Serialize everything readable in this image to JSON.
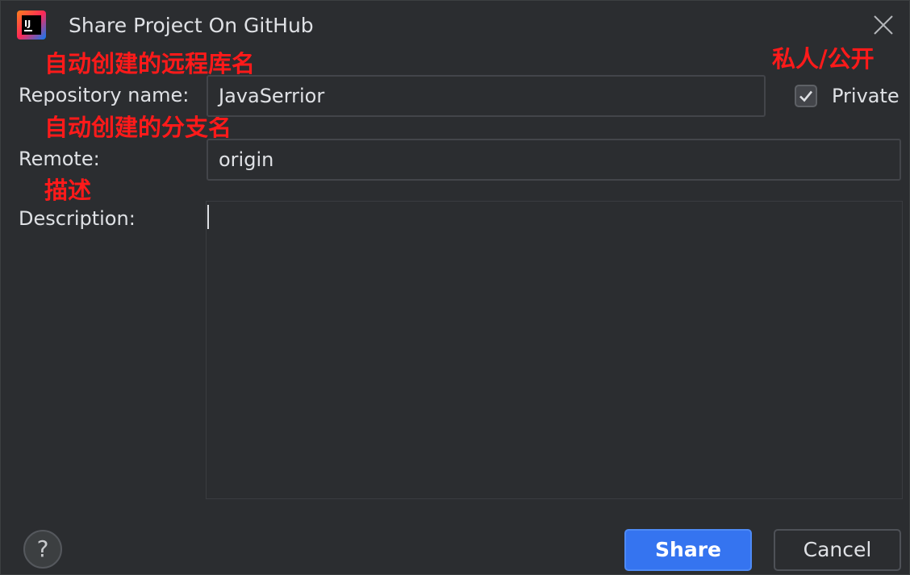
{
  "window": {
    "title": "Share Project On GitHub",
    "app_icon": "intellij-idea-icon",
    "close_icon": "close-icon"
  },
  "annotations": {
    "repo_name_note": "自动创建的远程库名",
    "remote_note": "自动创建的分支名",
    "description_note": "描述",
    "private_note": "私人/公开"
  },
  "form": {
    "repository_name_label": "Repository name:",
    "repository_name_value": "JavaSerrior",
    "remote_label": "Remote:",
    "remote_value": "origin",
    "description_label": "Description:",
    "description_value": "",
    "private_label": "Private",
    "private_checked": true
  },
  "footer": {
    "help_label": "?",
    "share_label": "Share",
    "cancel_label": "Cancel"
  },
  "colors": {
    "background": "#2b2d30",
    "annotation": "#ff1a1a",
    "primary_button": "#3574f0",
    "text": "#dfe1e5"
  }
}
